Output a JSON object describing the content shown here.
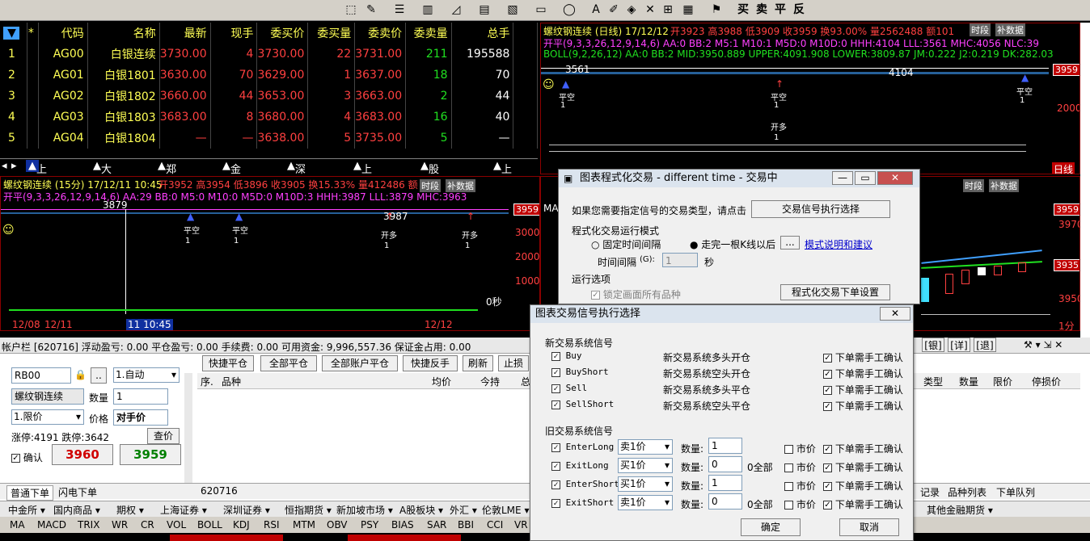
{
  "toolbar": {
    "buy": "买",
    "sell": "卖",
    "flat": "平",
    "reverse": "反"
  },
  "quote": {
    "headers": [
      "*",
      "代码",
      "名称",
      "最新",
      "现手",
      "委买价",
      "委买量",
      "委卖价",
      "委卖量",
      "总手"
    ],
    "rows": [
      {
        "idx": "1",
        "code": "AG00",
        "name": "白银连续",
        "last": "3730.00",
        "cur": "4",
        "bid": "3730.00",
        "bidvol": "22",
        "ask": "3731.00",
        "askvol": "211",
        "total": "195588"
      },
      {
        "idx": "2",
        "code": "AG01",
        "name": "白银1801",
        "last": "3630.00",
        "cur": "70",
        "bid": "3629.00",
        "bidvol": "1",
        "ask": "3637.00",
        "askvol": "18",
        "total": "70"
      },
      {
        "idx": "3",
        "code": "AG02",
        "name": "白银1802",
        "last": "3660.00",
        "cur": "44",
        "bid": "3653.00",
        "bidvol": "3",
        "ask": "3663.00",
        "askvol": "2",
        "total": "44"
      },
      {
        "idx": "4",
        "code": "AG03",
        "name": "白银1803",
        "last": "3683.00",
        "cur": "8",
        "bid": "3680.00",
        "bidvol": "4",
        "ask": "3683.00",
        "askvol": "16",
        "total": "40"
      },
      {
        "idx": "5",
        "code": "AG04",
        "name": "白银1804",
        "last": "—",
        "cur": "—",
        "bid": "3638.00",
        "bidvol": "5",
        "ask": "3735.00",
        "askvol": "5",
        "total": "—"
      }
    ]
  },
  "market_tabs": [
    "上海期货",
    "大连期货",
    "郑州期货",
    "金融期货",
    "深圳指数",
    "上海指数",
    "股期T报价",
    "上海"
  ],
  "chart_top": {
    "title": "螺纹钢连续 (日线) 17/12/12",
    "ohlc": "开3923 高3988 低3909 收3959 换93.00% 量2562488 额101",
    "line2": "开平(9,3,3,26,12,9,14,6) AA:0 BB:2 M5:1 M10:1 M5D:0 M10D:0 HHH:4104 LLL:3561 MHC:4056 NLC:39",
    "line3": "BOLL(9,2,26,12) AA:0 BB:2 MID:3950.889 UPPER:4091.908 LOWER:3809.87 JM:0.222 J2:0.219 DK:282.03",
    "lbl_3561": "3561",
    "lbl_4104": "4104",
    "price_tag": "3959",
    "axis_2000": "2000",
    "sig_a": "平空",
    "sig_b": "开多",
    "one": "1",
    "tab_shiduan": "时段",
    "tab_buchang": "补数据",
    "tab_rixian": "日线"
  },
  "chart_mid": {
    "title": "螺纹钢连续 (15分) 17/12/11 10:45",
    "ohlc": "开3952 高3954 低3896 收3905 换15.33% 量412486 额",
    "line2": "开平(9,3,3,26,12,9,14,6) AA:29 BB:0 M5:0 M10:0 M5D:0 M10D:3 HHH:3987 LLL:3879 MHC:3963",
    "lbl_3879": "3879",
    "lbl_3987": "3987",
    "price_tag": "3959",
    "axis_3000": "3000",
    "axis_2000": "2000",
    "axis_1000": "1000",
    "sig_a": "平空",
    "sig_b": "开多",
    "one": "1",
    "zero_sec": "0秒",
    "date1": "12/08",
    "date2": "12/11",
    "cursor_time": "11 10:45",
    "date3": "12/12",
    "tab_shiduan": "时段",
    "tab_buchang": "补数据"
  },
  "chart_right_mid": {
    "line": "MA 量4,7",
    "tag1": "3959",
    "tag2": "3935",
    "axis_3970": "3970",
    "axis_3950": "3950",
    "tab_shiduan": "时段",
    "tab_buchang": "补数据",
    "fen": "1分"
  },
  "account": {
    "bar": "帐户栏 [620716] 浮动盈亏: 0.00 平仓盈亏: 0.00 手续费: 0.00 可用资金: 9,996,557.36 保证金占用: 0.00",
    "symbol": "RB00",
    "dots": "..",
    "mode": "1.自动",
    "name": "螺纹钢连续",
    "qty_label": "数量",
    "qty": "1",
    "order_type": "1.限价",
    "price_label": "价格",
    "price": "对手价",
    "limits": "涨停:4191 跌停:3642",
    "query": "查价",
    "confirm": "确认",
    "buy_price": "3960",
    "sell_price": "3959",
    "buttons": [
      "快捷平仓",
      "全部平仓",
      "全部账户平仓",
      "快捷反手",
      "刷新",
      "止损"
    ],
    "cols": [
      "序.",
      "品种",
      "均价",
      "今持",
      "总"
    ],
    "right_cols": [
      "类型",
      "数量",
      "限价",
      "停损价"
    ],
    "right_btns": [
      "银",
      "详",
      "退"
    ],
    "account_id": "620716",
    "tab_normal": "普通下单",
    "tab_flash": "闪电下单",
    "right_tabs": [
      "记录",
      "品种列表",
      "下单队列"
    ]
  },
  "prog_dialog": {
    "title": "图表程式化交易 - different time - 交易中",
    "hint": "如果您需要指定信号的交易类型，请点击",
    "select_btn": "交易信号执行选择",
    "mode_title": "程式化交易运行模式",
    "fixed": "固定时间间隔",
    "after_bar": "走完一根K线以后",
    "dots": "...",
    "mode_help": "模式说明和建议",
    "interval": "时间间隔",
    "interval_key": "(G):",
    "interval_val": "1",
    "sec": "秒",
    "run_title": "运行选项",
    "lock": "锁定画面所有品种",
    "order_set": "程式化交易下单设置"
  },
  "signal_dialog": {
    "title": "图表交易信号执行选择",
    "new_title": "新交易系统信号",
    "new_signals": [
      {
        "name": "Buy",
        "desc": "新交易系统多头开仓",
        "confirm": "下单需手工确认"
      },
      {
        "name": "BuyShort",
        "desc": "新交易系统空头开仓",
        "confirm": "下单需手工确认"
      },
      {
        "name": "Sell",
        "desc": "新交易系统多头平仓",
        "confirm": "下单需手工确认"
      },
      {
        "name": "SellShort",
        "desc": "新交易系统空头平仓",
        "confirm": "下单需手工确认"
      }
    ],
    "old_title": "旧交易系统信号",
    "old_signals": [
      {
        "name": "EnterLong",
        "price": "卖1价",
        "qty": "1",
        "all": "",
        "market": "市价",
        "confirm": "下单需手工确认"
      },
      {
        "name": "ExitLong",
        "price": "买1价",
        "qty": "0",
        "all": "0全部",
        "market": "市价",
        "confirm": "下单需手工确认"
      },
      {
        "name": "EnterShort",
        "price": "买1价",
        "qty": "1",
        "all": "",
        "market": "市价",
        "confirm": "下单需手工确认"
      },
      {
        "name": "ExitShort",
        "price": "卖1价",
        "qty": "0",
        "all": "0全部",
        "market": "市价",
        "confirm": "下单需手工确认"
      }
    ],
    "qty_label": "数量:",
    "ok": "确定",
    "cancel": "取消"
  },
  "bottom_tabs": [
    "中金所",
    "国内商品",
    "期权",
    "上海证券",
    "深圳证券",
    "恒指期货",
    "新加坡市场",
    "A股板块",
    "外汇",
    "伦敦LME",
    "其他金融期货"
  ],
  "indicators": [
    "MA",
    "MACD",
    "TRIX",
    "WR",
    "CR",
    "VOL",
    "BOLL",
    "KDJ",
    "RSI",
    "MTM",
    "OBV",
    "PSY",
    "BIAS",
    "SAR",
    "BBI",
    "CCI",
    "VR"
  ],
  "colors": {
    "up": "#ff4040",
    "down": "#20e020",
    "label": "#ffff55"
  }
}
